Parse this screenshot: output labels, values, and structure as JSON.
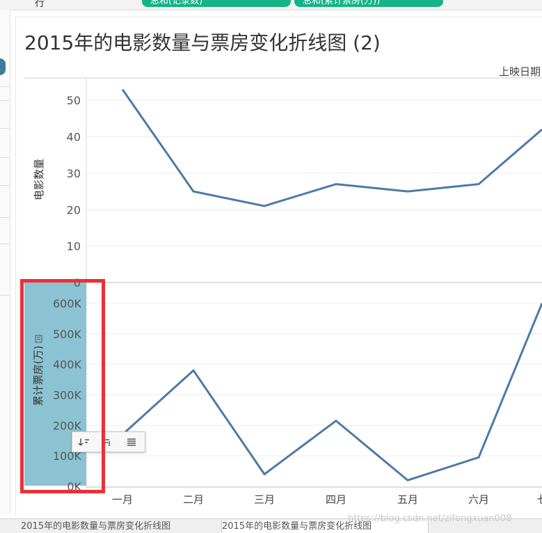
{
  "shelf": {
    "row_label": "行",
    "pill_1": "总和(记录数)",
    "pill_2": "总和(累计票房(万))"
  },
  "title": "2015年的电影数量与票房变化折线图 (2)",
  "column_header": "上映日期",
  "popup_icons": [
    "sort-ascending-icon",
    "sort-descending-icon",
    "sort-menu-icon"
  ],
  "bottom_tabs": [
    "2015年的电影数量与票房变化折线图",
    "2015年的电影数量与票房变化折线图"
  ],
  "watermark": "https://blog.csdn.net/zifongxuan008",
  "colors": {
    "line": "#4e79a7",
    "accent_pill": "#15b388",
    "axis_highlight": "#8cc3d3",
    "highlight_border": "#ee2e35"
  },
  "chart_data": [
    {
      "type": "line",
      "x": [
        "一月",
        "二月",
        "三月",
        "四月",
        "五月",
        "六月",
        "七月"
      ],
      "series": [
        {
          "values": [
            53,
            25,
            21,
            27,
            25,
            27,
            42
          ]
        }
      ],
      "xlabel": "",
      "ylabel": "电影数量",
      "ylim": [
        0,
        55
      ],
      "yticks": [
        0,
        10,
        20,
        30,
        40,
        50
      ],
      "ytick_labels": [
        "0",
        "10",
        "20",
        "30",
        "40",
        "50"
      ],
      "grid": true
    },
    {
      "type": "line",
      "x": [
        "一月",
        "二月",
        "三月",
        "四月",
        "五月",
        "六月",
        "七月"
      ],
      "series": [
        {
          "values": [
            170000,
            380000,
            40000,
            215000,
            20000,
            95000,
            600000
          ]
        }
      ],
      "xlabel": "",
      "ylabel": "累计票房(万)",
      "ylim": [
        0,
        650000
      ],
      "yticks": [
        0,
        100000,
        200000,
        300000,
        400000,
        500000,
        600000
      ],
      "ytick_labels": [
        "0K",
        "100K",
        "200K",
        "300K",
        "400K",
        "500K",
        "600K"
      ],
      "x_tick_labels": [
        "一月",
        "二月",
        "三月",
        "四月",
        "五月",
        "六月",
        "七"
      ],
      "grid": true
    }
  ]
}
